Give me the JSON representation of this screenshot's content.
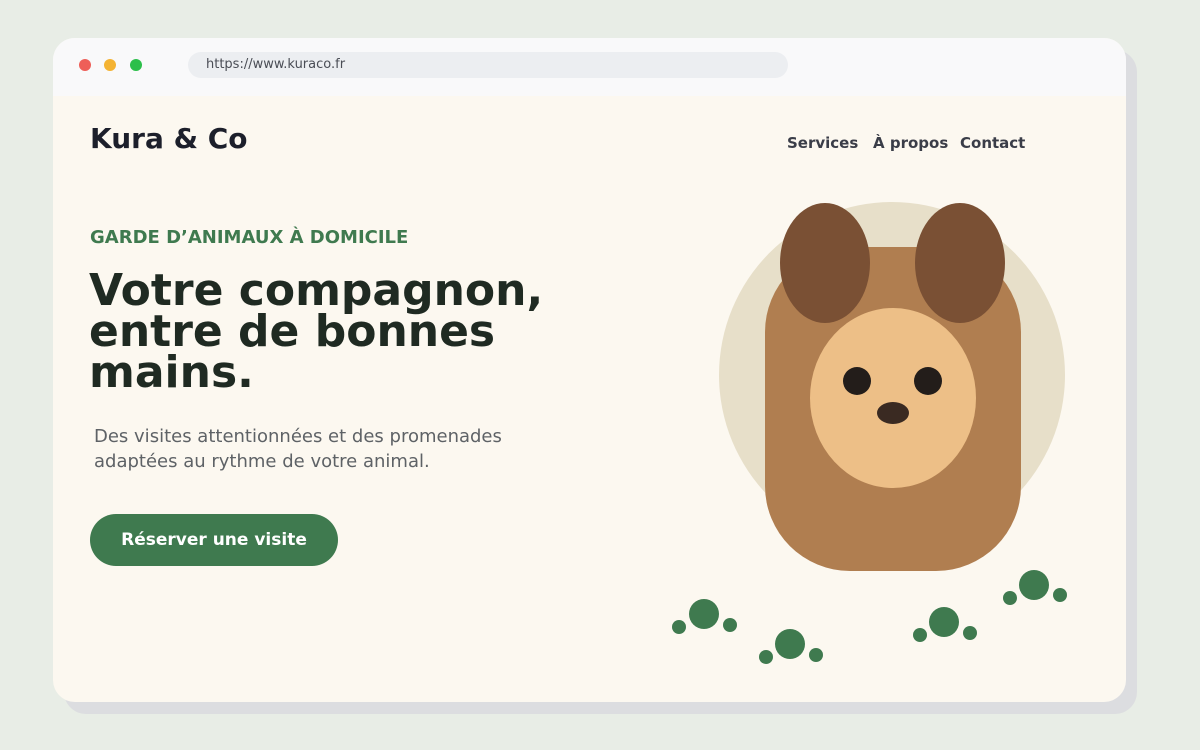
{
  "browser": {
    "url": "https://www.kuraco.fr",
    "traffic_lights": {
      "close": "#ee5f58",
      "minimize": "#f4b333",
      "maximize": "#2cbf4a"
    }
  },
  "site": {
    "brand": "Kura & Co",
    "nav": {
      "services": "Services",
      "about": "À propos",
      "contact": "Contact"
    }
  },
  "hero": {
    "eyebrow": "GARDE D’ANIMAUX À DOMICILE",
    "headline": "Votre compagnon, entre de bonnes mains.",
    "subtitle": "Des visites attentionnées et des promenades adaptées au rythme de votre animal.",
    "cta_label": "Réserver une visite"
  },
  "colors": {
    "accent": "#3f7a4f",
    "page_background": "#fcf8f0",
    "dog_fur": "#b07e50",
    "dog_ears": "#7a5034",
    "dog_muzzle": "#edbf87",
    "halo": "#e7dfc9"
  },
  "illustration": {
    "subject": "dog-illustration",
    "decor": "paw-prints"
  }
}
